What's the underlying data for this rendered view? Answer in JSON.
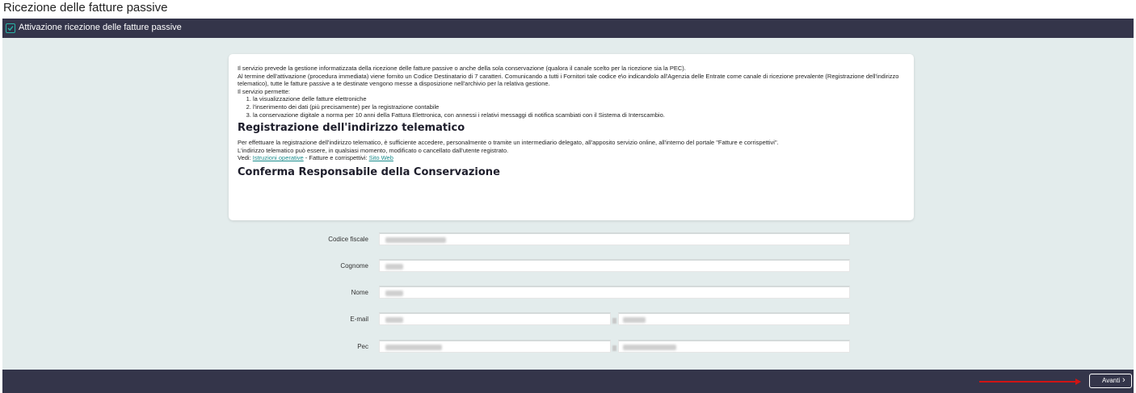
{
  "page": {
    "title": "Ricezione delle fatture passive"
  },
  "section": {
    "label": "Attivazione ricezione delle fatture passive",
    "checked": true
  },
  "info": {
    "p1": "Il servizio prevede la gestione informatizzata della ricezione delle fatture passive o anche della sola conservazione (qualora il canale scelto per la ricezione sia la PEC).",
    "p2": "Al termine dell'attivazione (procedura immediata) viene fornito un Codice Destinatario di 7 caratteri. Comunicando a tutti i Fornitori tale codice e\\o indicandolo all'Agenzia delle Entrate come canale di ricezione prevalente (Registrazione dell'indirizzo telematico), tutte le fatture passive a te destinate vengono messe a disposizione nell'archivio per la relativa gestione.",
    "p3": "Il servizio permette:",
    "list": [
      "la visualizzazione delle fatture elettroniche",
      "l'inserimento dei dati (più precisamente) per la registrazione contabile",
      "la conservazione digitale a norma per 10 anni della Fattura Elettronica, con annessi i relativi messaggi di notifica scambiati con il Sistema di Interscambio."
    ],
    "heading1": "Registrazione dell'indirizzo telematico",
    "p4": "Per effettuare la registrazione dell'indirizzo telematico, è sufficiente accedere, personalmente o tramite un intermediario delegato, all'apposito servizio online, all'interno del portale \"Fatture e corrispettivi\".",
    "p5": "L'indirizzo telematico può essere, in qualsiasi momento, modificato o cancellato dall'utente registrato.",
    "vedi_prefix": "Vedi: ",
    "vedi_link1": "Istruzioni operative",
    "vedi_middle": " - Fatture e corrispettivi: ",
    "vedi_link2": "Sito Web",
    "heading2": "Conferma Responsabile della Conservazione"
  },
  "form": {
    "codice_fiscale_label": "Codice fiscale",
    "cognome_label": "Cognome",
    "nome_label": "Nome",
    "email_label": "E-mail",
    "pec_label": "Pec"
  },
  "footer": {
    "next_label": "Avanti"
  },
  "colors": {
    "header_bg": "#34354a",
    "content_bg": "#e3ecec",
    "accent": "#1a8c8c",
    "arrow": "#d01414"
  },
  "icons": {
    "checkbox": "checkbox-checked-icon",
    "next": "chevron-right-icon"
  }
}
